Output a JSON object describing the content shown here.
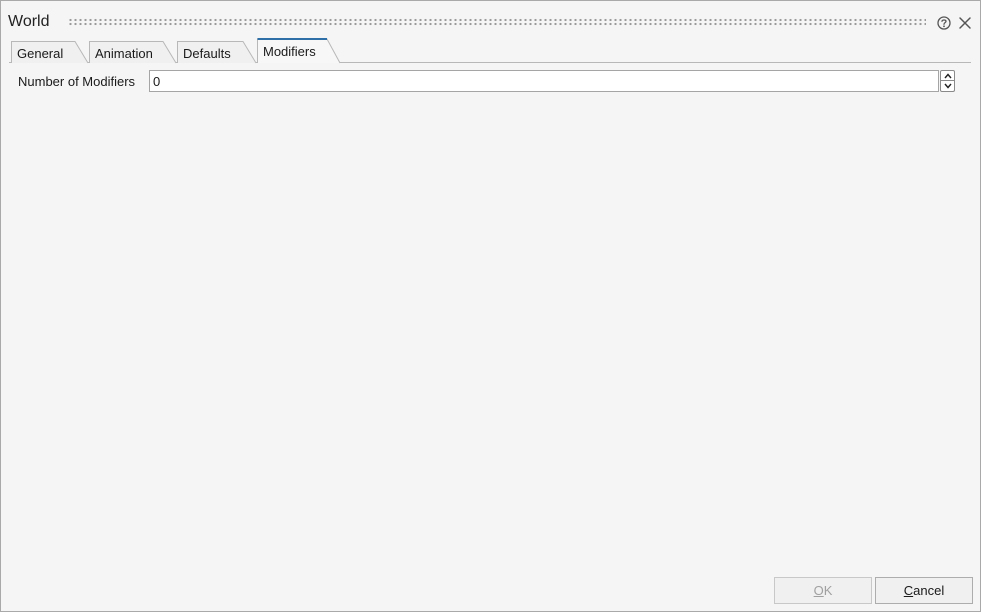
{
  "window": {
    "title": "World"
  },
  "tabs": [
    {
      "label": "General",
      "active": false
    },
    {
      "label": "Animation",
      "active": false
    },
    {
      "label": "Defaults",
      "active": false
    },
    {
      "label": "Modifiers",
      "active": true
    }
  ],
  "modifiers": {
    "count_label": "Number of Modifiers",
    "count_value": "0"
  },
  "footer": {
    "ok_label": "OK",
    "cancel_label": "Cancel",
    "ok_enabled": false
  },
  "icons": {
    "help": "help-circle-icon",
    "close": "close-icon",
    "spin_up": "chevron-up-icon",
    "spin_down": "chevron-down-icon"
  },
  "colors": {
    "active_tab_accent": "#2f6fa7",
    "background": "#f5f5f5",
    "disabled_text": "#a0a0a0"
  }
}
